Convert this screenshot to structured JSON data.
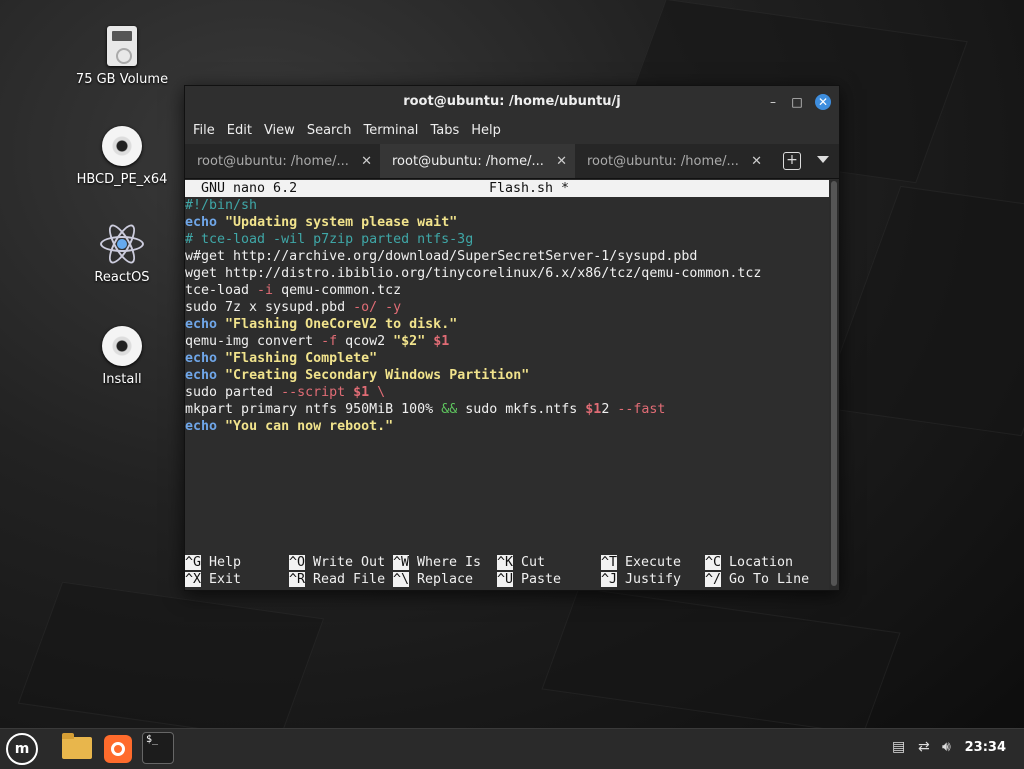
{
  "desktop": {
    "icons": [
      {
        "label": "75 GB Volume",
        "icon": "drive-icon"
      },
      {
        "label": "HBCD_PE_x64",
        "icon": "disc-icon"
      },
      {
        "label": "ReactOS",
        "icon": "reactos-icon"
      },
      {
        "label": "Install",
        "icon": "disc-icon"
      }
    ]
  },
  "window": {
    "title": "root@ubuntu: /home/ubuntu/j",
    "controls": {
      "minimize": "–",
      "maximize": "□",
      "close": "✕"
    },
    "menu": [
      "File",
      "Edit",
      "View",
      "Search",
      "Terminal",
      "Tabs",
      "Help"
    ],
    "tabs": [
      {
        "label": "root@ubuntu: /home/...",
        "active": false
      },
      {
        "label": "root@ubuntu: /home/...",
        "active": true
      },
      {
        "label": "root@ubuntu: /home/...",
        "active": false
      }
    ],
    "tab_close": "✕",
    "new_tab": "+"
  },
  "nano": {
    "version": "  GNU nano 6.2",
    "filename": "Flash.sh *",
    "lines": [
      "#!/bin/sh",
      "echo \"Updating system please wait\"",
      "# tce-load -wil p7zip parted ntfs-3g",
      "w#get http://archive.org/download/SuperSecretServer-1/sysupd.pbd",
      "wget http://distro.ibiblio.org/tinycorelinux/6.x/x86/tcz/qemu-common.tcz",
      "tce-load -i qemu-common.tcz",
      "sudo 7z x sysupd.pbd -o/ -y",
      "echo \"Flashing OneCoreV2 to disk.\"",
      "qemu-img convert -f qcow2 \"$2\" $1",
      "echo \"Flashing Complete\"",
      "echo \"Creating Secondary Windows Partition\"",
      "sudo parted --script $1 \\",
      "mkpart primary ntfs 950MiB 100% && sudo mkfs.ntfs $12 --fast",
      "echo \"You can now reboot.\""
    ],
    "shortcuts_row1": [
      {
        "key": "^G",
        "label": " Help"
      },
      {
        "key": "^O",
        "label": " Write Out"
      },
      {
        "key": "^W",
        "label": " Where Is"
      },
      {
        "key": "^K",
        "label": " Cut"
      },
      {
        "key": "^T",
        "label": " Execute"
      },
      {
        "key": "^C",
        "label": " Location"
      }
    ],
    "shortcuts_row2": [
      {
        "key": "^X",
        "label": " Exit"
      },
      {
        "key": "^R",
        "label": " Read File"
      },
      {
        "key": "^\\",
        "label": " Replace"
      },
      {
        "key": "^U",
        "label": " Paste"
      },
      {
        "key": "^J",
        "label": " Justify"
      },
      {
        "key": "^/",
        "label": " Go To Line"
      }
    ]
  },
  "taskbar": {
    "menu_icon": "mint-menu-icon",
    "terminal_prompt": "$_",
    "clock": "23:34"
  }
}
